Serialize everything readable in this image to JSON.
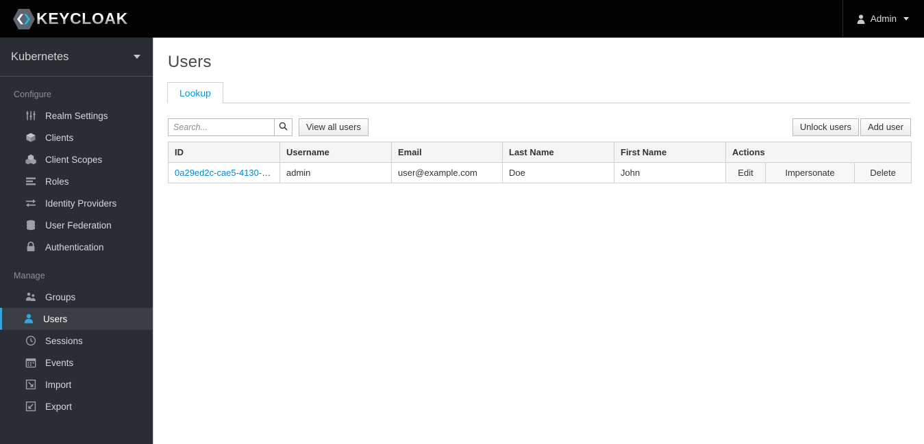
{
  "masthead": {
    "brand_text": "KEYCLOAK",
    "brand_icon": "keycloak-logo-icon",
    "user_icon": "user-icon",
    "user_label": "Admin",
    "caret_icon": "chevron-down-icon"
  },
  "sidebar": {
    "realm": {
      "name": "Kubernetes",
      "caret_icon": "chevron-down-icon"
    },
    "sections": [
      {
        "title": "Configure",
        "items": [
          {
            "label": "Realm Settings",
            "icon": "sliders-icon",
            "active": false
          },
          {
            "label": "Clients",
            "icon": "cube-icon",
            "active": false
          },
          {
            "label": "Client Scopes",
            "icon": "cubes-icon",
            "active": false
          },
          {
            "label": "Roles",
            "icon": "list-bars-icon",
            "active": false
          },
          {
            "label": "Identity Providers",
            "icon": "exchange-arrows-icon",
            "active": false
          },
          {
            "label": "User Federation",
            "icon": "database-icon",
            "active": false
          },
          {
            "label": "Authentication",
            "icon": "lock-icon",
            "active": false
          }
        ]
      },
      {
        "title": "Manage",
        "items": [
          {
            "label": "Groups",
            "icon": "group-users-icon",
            "active": false
          },
          {
            "label": "Users",
            "icon": "user-icon",
            "active": true
          },
          {
            "label": "Sessions",
            "icon": "clock-icon",
            "active": false
          },
          {
            "label": "Events",
            "icon": "calendar-icon",
            "active": false
          },
          {
            "label": "Import",
            "icon": "import-arrow-icon",
            "active": false
          },
          {
            "label": "Export",
            "icon": "export-arrow-icon",
            "active": false
          }
        ]
      }
    ]
  },
  "main": {
    "page_title": "Users",
    "tabs": [
      {
        "label": "Lookup",
        "active": true
      }
    ],
    "toolbar": {
      "search_placeholder": "Search...",
      "search_value": "",
      "search_icon": "search-icon",
      "view_all_label": "View all users",
      "unlock_users_label": "Unlock users",
      "add_user_label": "Add user"
    },
    "table": {
      "columns": [
        "ID",
        "Username",
        "Email",
        "Last Name",
        "First Name",
        "Actions"
      ],
      "rows": [
        {
          "id": "0a29ed2c-cae5-4130-9c...",
          "username": "admin",
          "email": "user@example.com",
          "last_name": "Doe",
          "first_name": "John",
          "actions": [
            "Edit",
            "Impersonate",
            "Delete"
          ]
        }
      ]
    }
  },
  "colors": {
    "masthead_bg": "#030303",
    "sidebar_bg": "#292e34",
    "sidebar_active_bg": "#393f44",
    "accent_blue": "#39a5dc",
    "link_blue": "#0088ce",
    "tab_blue": "#0099d3",
    "content_bg": "#ffffff",
    "table_header_bg": "#f5f5f5",
    "border_gray": "#d1d1d1"
  }
}
